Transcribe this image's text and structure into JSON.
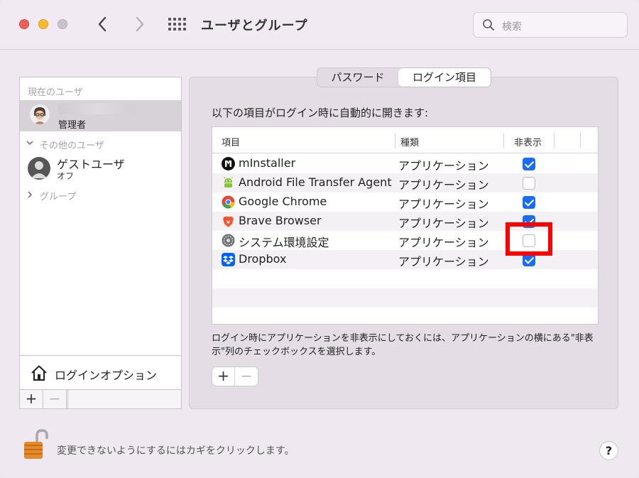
{
  "window": {
    "title": "ユーザとグループ",
    "nav_back": "〈",
    "nav_forward": "〉",
    "search_placeholder": "検索"
  },
  "sidebar": {
    "current_users_label": "現在のユーザ",
    "admin_role": "管理者",
    "other_users_label": "その他のユーザ",
    "guest_name": "ゲストユーザ",
    "guest_status": "オフ",
    "groups_label": "グループ",
    "login_options_label": "ログインオプション",
    "add_label": "+",
    "remove_label": "−"
  },
  "tabs": [
    {
      "label": "パスワード",
      "selected": false
    },
    {
      "label": "ログイン項目",
      "selected": true
    }
  ],
  "main": {
    "intro": "以下の項目がログイン時に自動的に開きます:",
    "columns": {
      "item": "項目",
      "kind": "種類",
      "hide": "非表示"
    },
    "rows": [
      {
        "name": "mInstaller",
        "kind": "アプリケーション",
        "hidden": true,
        "icon": "minstaller-icon",
        "color": "#111111"
      },
      {
        "name": "Android File Transfer Agent",
        "kind": "アプリケーション",
        "hidden": false,
        "icon": "android-icon",
        "color": "#8ac33e"
      },
      {
        "name": "Google Chrome",
        "kind": "アプリケーション",
        "hidden": true,
        "icon": "chrome-icon",
        "color": "#e8453c"
      },
      {
        "name": "Brave Browser",
        "kind": "アプリケーション",
        "hidden": true,
        "icon": "brave-icon",
        "color": "#fb542b"
      },
      {
        "name": "システム環境設定",
        "kind": "アプリケーション",
        "hidden": false,
        "icon": "system-preferences-icon",
        "color": "#6e6e73"
      },
      {
        "name": "Dropbox",
        "kind": "アプリケーション",
        "hidden": true,
        "icon": "dropbox-icon",
        "color": "#0061fe"
      }
    ],
    "help_text": "ログイン時にアプリケーションを非表示にしておくには、アプリケーションの横にある\"非表示\"列のチェックボックスを選択します。",
    "add_label": "+",
    "remove_label": "−"
  },
  "footer": {
    "lock_text": "変更できないようにするにはカギをクリックします。",
    "help_label": "?"
  },
  "colors": {
    "accent": "#1a6cf2",
    "highlight": "#ff0000"
  }
}
